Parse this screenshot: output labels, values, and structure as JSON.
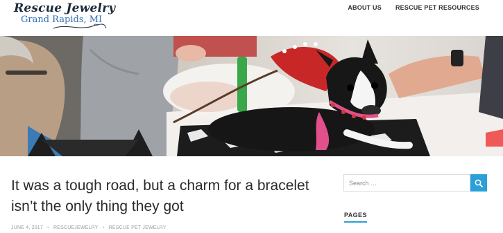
{
  "site": {
    "title": "Rescue Jewelry",
    "subtitle": "Grand Rapids, MI"
  },
  "nav": {
    "items": [
      {
        "label": "ABOUT US"
      },
      {
        "label": "RESCUE PET RESOURCES"
      }
    ]
  },
  "post": {
    "title": "It was a tough road, but a charm for a bracelet isn’t the only thing they got",
    "date": "JUNE 4, 2017",
    "author": "RESCUEJEWELRY",
    "category": "RESCUE PET JEWELRY",
    "separator": "•"
  },
  "sidebar": {
    "search": {
      "placeholder": "Search …"
    },
    "widget_title": "PAGES"
  },
  "colors": {
    "accent": "#2a9fd8",
    "logo_title": "#1e2a3a",
    "logo_sub": "#2f6fb3"
  },
  "icons": {
    "search_button": "search-icon"
  }
}
